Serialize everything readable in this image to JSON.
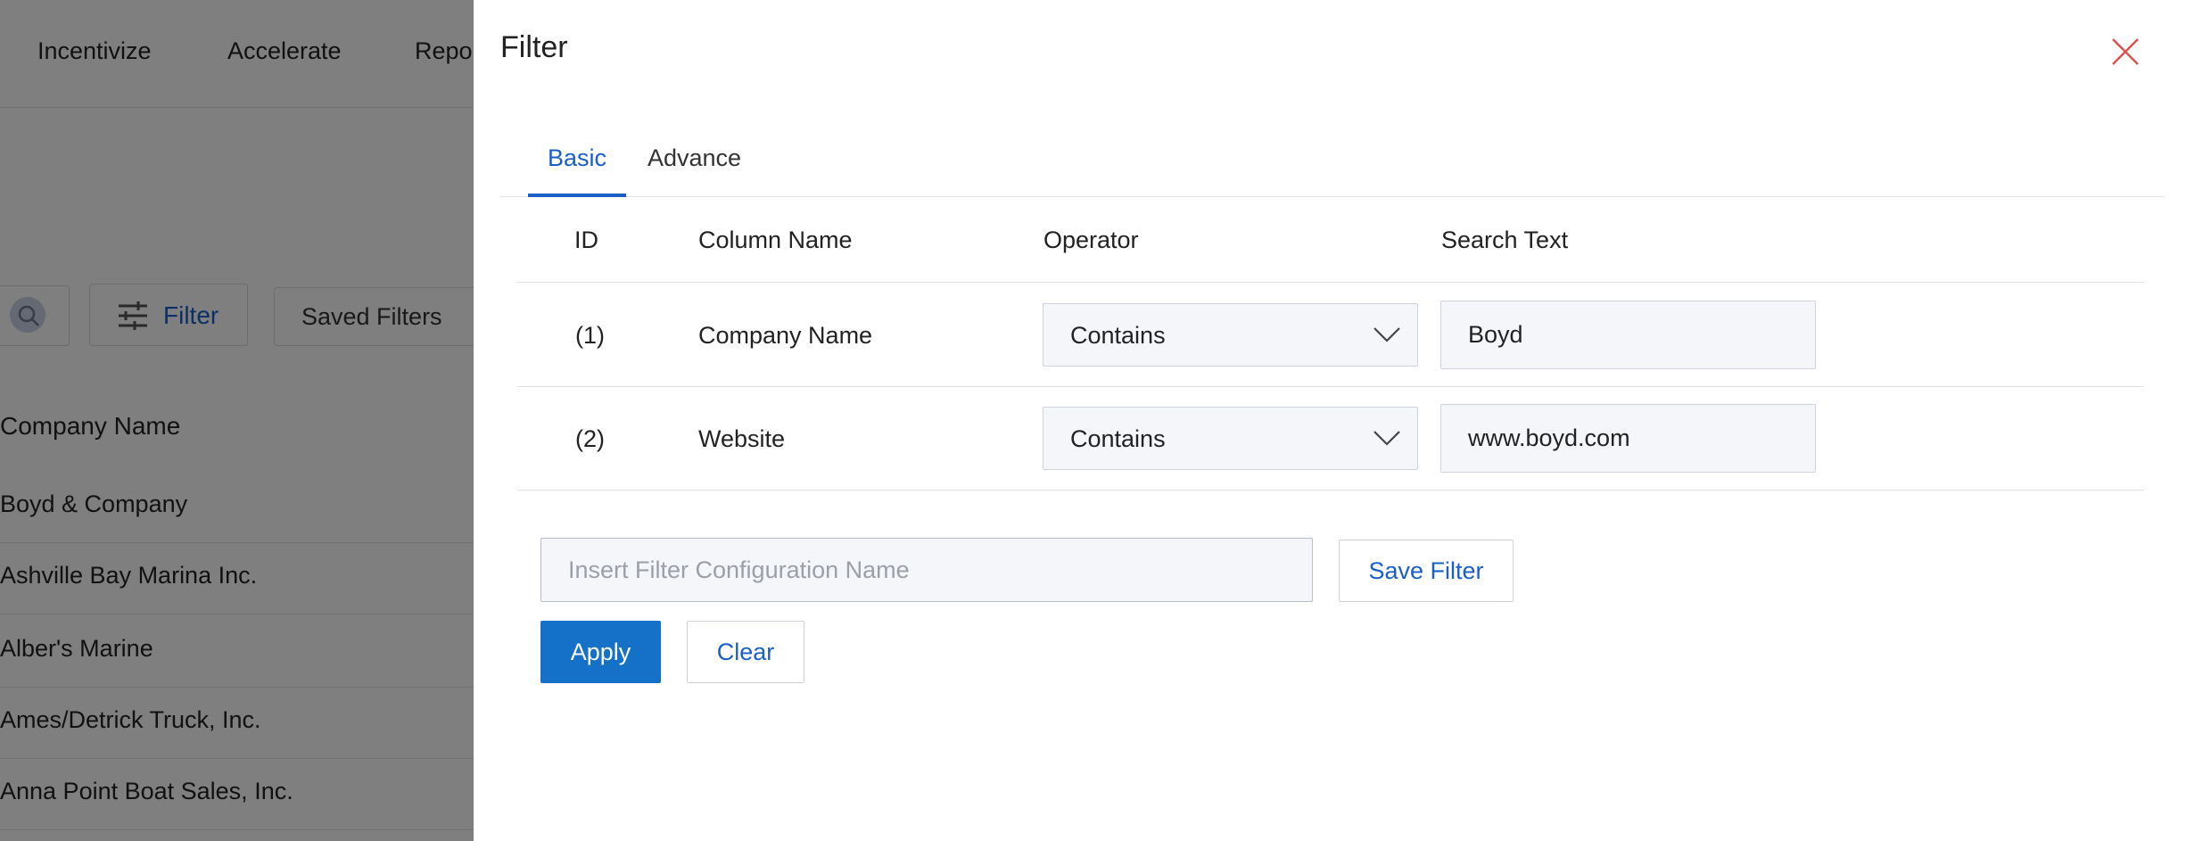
{
  "background": {
    "nav": [
      "Incentivize",
      "Accelerate",
      "Repor"
    ],
    "toolbar": {
      "filter_label": "Filter",
      "saved_filters_label": "Saved Filters"
    },
    "table_header": "Company Name",
    "rows": [
      "Boyd & Company",
      "Ashville Bay Marina Inc.",
      "Alber's Marine",
      "Ames/Detrick Truck, Inc.",
      "Anna Point Boat Sales, Inc."
    ]
  },
  "drawer": {
    "title": "Filter",
    "tabs": [
      {
        "label": "Basic",
        "active": true
      },
      {
        "label": "Advance",
        "active": false
      }
    ],
    "columns": [
      "ID",
      "Column Name",
      "Operator",
      "Search Text"
    ],
    "rows": [
      {
        "id": "(1)",
        "column": "Company Name",
        "operator": "Contains",
        "search": "Boyd"
      },
      {
        "id": "(2)",
        "column": "Website",
        "operator": "Contains",
        "search": "www.boyd.com"
      }
    ],
    "config_placeholder": "Insert Filter Configuration Name",
    "save_filter_label": "Save Filter",
    "apply_label": "Apply",
    "clear_label": "Clear"
  },
  "colors": {
    "accent": "#1a5fc8",
    "primary_button": "#1570c8",
    "close_icon": "#d9534f",
    "overlay": "rgba(0,0,0,0.5)"
  }
}
